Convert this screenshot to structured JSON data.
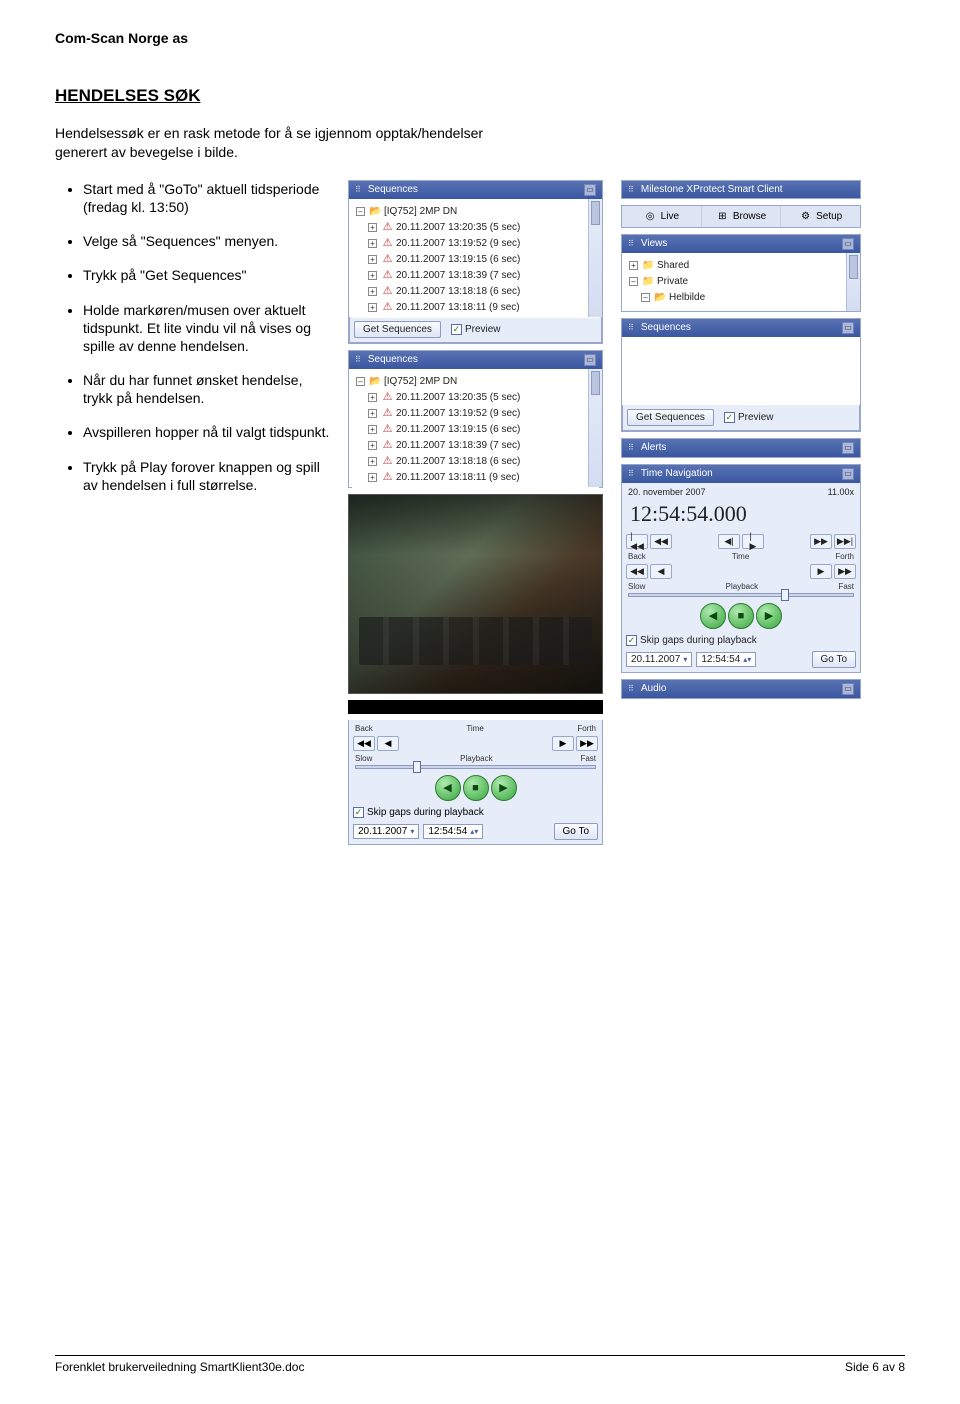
{
  "company": "Com-Scan Norge as",
  "heading": "HENDELSES SØK",
  "intro": "Hendelsessøk er en rask metode for å se igjennom opptak/hendelser generert av bevegelse i bilde.",
  "bullets": [
    "Start med å \"GoTo\" aktuell tidsperiode (fredag kl. 13:50)",
    "Velge så \"Sequences\" menyen.",
    "Trykk på \"Get Sequences\"",
    "Holde markøren/musen over aktuelt tidspunkt. Et lite vindu vil nå vises og spille av denne hendelsen.",
    "Når du har funnet ønsket hendelse, trykk på hendelsen.",
    "Avspilleren hopper nå til valgt tidspunkt.",
    "Trykk på Play forover knappen og spill av hendelsen i full størrelse."
  ],
  "app_title": "Milestone XProtect Smart Client",
  "toolbar": {
    "live": "Live",
    "browse": "Browse",
    "setup": "Setup"
  },
  "views_panel": {
    "title": "Views",
    "shared": "Shared",
    "private": "Private",
    "helbilde": "Helbilde"
  },
  "sequences_panel_title": "Sequences",
  "camera_name": "[IQ752] 2MP DN",
  "events": [
    "20.11.2007 13:20:35 (5 sec)",
    "20.11.2007 13:19:52 (9 sec)",
    "20.11.2007 13:19:15 (6 sec)",
    "20.11.2007 13:18:39 (7 sec)",
    "20.11.2007 13:18:18 (6 sec)",
    "20.11.2007 13:18:11 (9 sec)"
  ],
  "get_sequences": "Get Sequences",
  "preview": "Preview",
  "alerts_title": "Alerts",
  "timenav": {
    "title": "Time Navigation",
    "date": "20. november 2007",
    "speed": "11.00x",
    "time": "12:54:54.000",
    "back": "Back",
    "time_lbl": "Time",
    "forth": "Forth",
    "slow": "Slow",
    "playback": "Playback",
    "fast": "Fast",
    "skip": "Skip gaps during playback",
    "date_short": "20.11.2007",
    "time_short": "12:54:54",
    "goto": "Go To"
  },
  "audio_title": "Audio",
  "footer": {
    "left": "Forenklet brukerveiledning SmartKlient30e.doc",
    "right": "Side 6 av 8"
  }
}
